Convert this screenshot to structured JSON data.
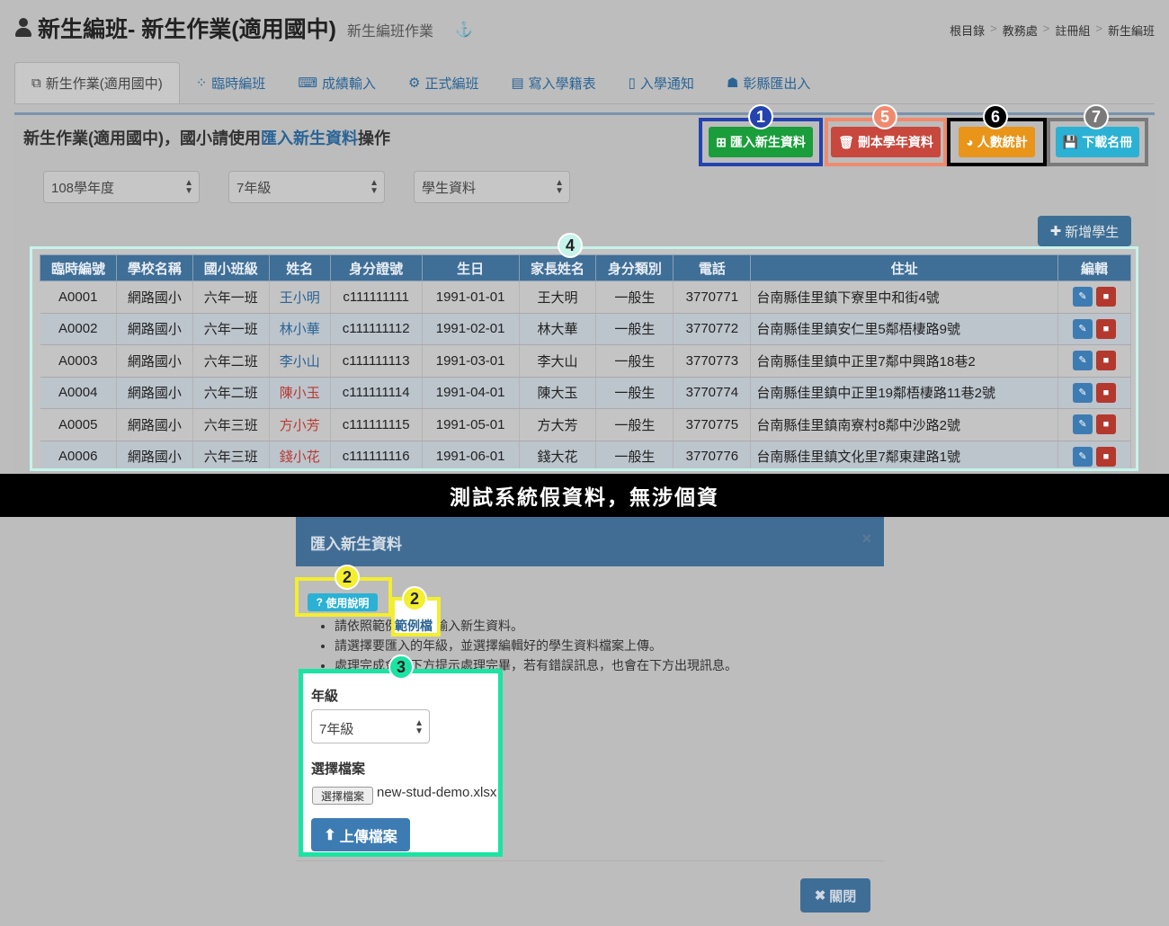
{
  "header": {
    "title": "新生編班- 新生作業(適用國中)",
    "subtitle": "新生編班作業",
    "anchor_icon": "anchor-icon"
  },
  "breadcrumb": [
    "根目錄",
    "教務處",
    "註冊組",
    "新生編班"
  ],
  "breadcrumb_sep": ">",
  "tabs": [
    {
      "label": "新生作業(適用國中)",
      "icon": "copy-icon"
    },
    {
      "label": "臨時編班",
      "icon": "spinner-icon"
    },
    {
      "label": "成績輸入",
      "icon": "keyboard-icon"
    },
    {
      "label": "正式編班",
      "icon": "gear-icon"
    },
    {
      "label": "寫入學籍表",
      "icon": "map-icon"
    },
    {
      "label": "入學通知",
      "icon": "file-icon"
    },
    {
      "label": "彰縣匯出入",
      "icon": "robot-icon"
    }
  ],
  "panel": {
    "title_prefix": "新生作業(適用國中)，國小請使用",
    "title_link": "匯入新生資料",
    "title_suffix": "操作"
  },
  "filters": {
    "year": "108學年度",
    "grade": "7年級",
    "type": "學生資料"
  },
  "actions": [
    {
      "label": "匯入新生資料",
      "badge": "1",
      "color": "#1a9d3b",
      "border": "#2443ae",
      "badge_color": "#2443ae",
      "icon": "plus-square-icon"
    },
    {
      "label": "刪本學年資料",
      "badge": "5",
      "color": "#c8483d",
      "border": "#f08a6e",
      "badge_color": "#f08a6e",
      "icon": "trash-icon"
    },
    {
      "label": "人數統計",
      "badge": "6",
      "color": "#e8951a",
      "border": "#000000",
      "badge_color": "#000000",
      "icon": "pie-chart-icon"
    },
    {
      "label": "下載名冊",
      "badge": "7",
      "color": "#2bb1d4",
      "border": "#7a7a7a",
      "badge_color": "#7a7a7a",
      "icon": "save-icon"
    }
  ],
  "add_student_label": "新增學生",
  "table_badge": "4",
  "table": {
    "columns": [
      "臨時編號",
      "學校名稱",
      "國小班級",
      "姓名",
      "身分證號",
      "生日",
      "家長姓名",
      "身分類別",
      "電話",
      "住址",
      "編輯"
    ],
    "rows": [
      {
        "id": "A0001",
        "school": "網路國小",
        "class": "六年一班",
        "name": "王小明",
        "name_color": "blue",
        "pid": "c111111111",
        "birthday": "1991-01-01",
        "parent": "王大明",
        "category": "一般生",
        "phone": "3770771",
        "address": "台南縣佳里鎮下寮里中和街4號"
      },
      {
        "id": "A0002",
        "school": "網路國小",
        "class": "六年一班",
        "name": "林小華",
        "name_color": "blue",
        "pid": "c111111112",
        "birthday": "1991-02-01",
        "parent": "林大華",
        "category": "一般生",
        "phone": "3770772",
        "address": "台南縣佳里鎮安仁里5鄰梧棲路9號"
      },
      {
        "id": "A0003",
        "school": "網路國小",
        "class": "六年二班",
        "name": "李小山",
        "name_color": "blue",
        "pid": "c111111113",
        "birthday": "1991-03-01",
        "parent": "李大山",
        "category": "一般生",
        "phone": "3770773",
        "address": "台南縣佳里鎮中正里7鄰中興路18巷2"
      },
      {
        "id": "A0004",
        "school": "網路國小",
        "class": "六年二班",
        "name": "陳小玉",
        "name_color": "red",
        "pid": "c111111114",
        "birthday": "1991-04-01",
        "parent": "陳大玉",
        "category": "一般生",
        "phone": "3770774",
        "address": "台南縣佳里鎮中正里19鄰梧棲路11巷2號"
      },
      {
        "id": "A0005",
        "school": "網路國小",
        "class": "六年三班",
        "name": "方小芳",
        "name_color": "red",
        "pid": "c111111115",
        "birthday": "1991-05-01",
        "parent": "方大芳",
        "category": "一般生",
        "phone": "3770775",
        "address": "台南縣佳里鎮南寮村8鄰中沙路2號"
      },
      {
        "id": "A0006",
        "school": "網路國小",
        "class": "六年三班",
        "name": "錢小花",
        "name_color": "red",
        "pid": "c111111116",
        "birthday": "1991-06-01",
        "parent": "錢大花",
        "category": "一般生",
        "phone": "3770776",
        "address": "台南縣佳里鎮文化里7鄰東建路1號"
      }
    ]
  },
  "banner": "測試系統假資料，無涉個資",
  "modal": {
    "title": "匯入新生資料",
    "close_x": "×",
    "help_label": "使用說明",
    "help_badge": "2",
    "sample_label": "範例檔",
    "sample_badge": "2",
    "instructions": [
      "請依照範例檔格式輸入新生資料。",
      "請選擇要匯入的年級，並選擇編輯好的學生資料檔案上傳。",
      "處理完成會在下方提示處理完畢，若有錯誤訊息，也會在下方出現訊息。"
    ],
    "upload_badge": "3",
    "grade_label": "年級",
    "grade_value": "7年級",
    "file_label": "選擇檔案",
    "file_button": "選擇檔案",
    "file_name": "new-stud-demo.xlsx",
    "upload_button": "上傳檔案",
    "close_button": "關閉"
  }
}
